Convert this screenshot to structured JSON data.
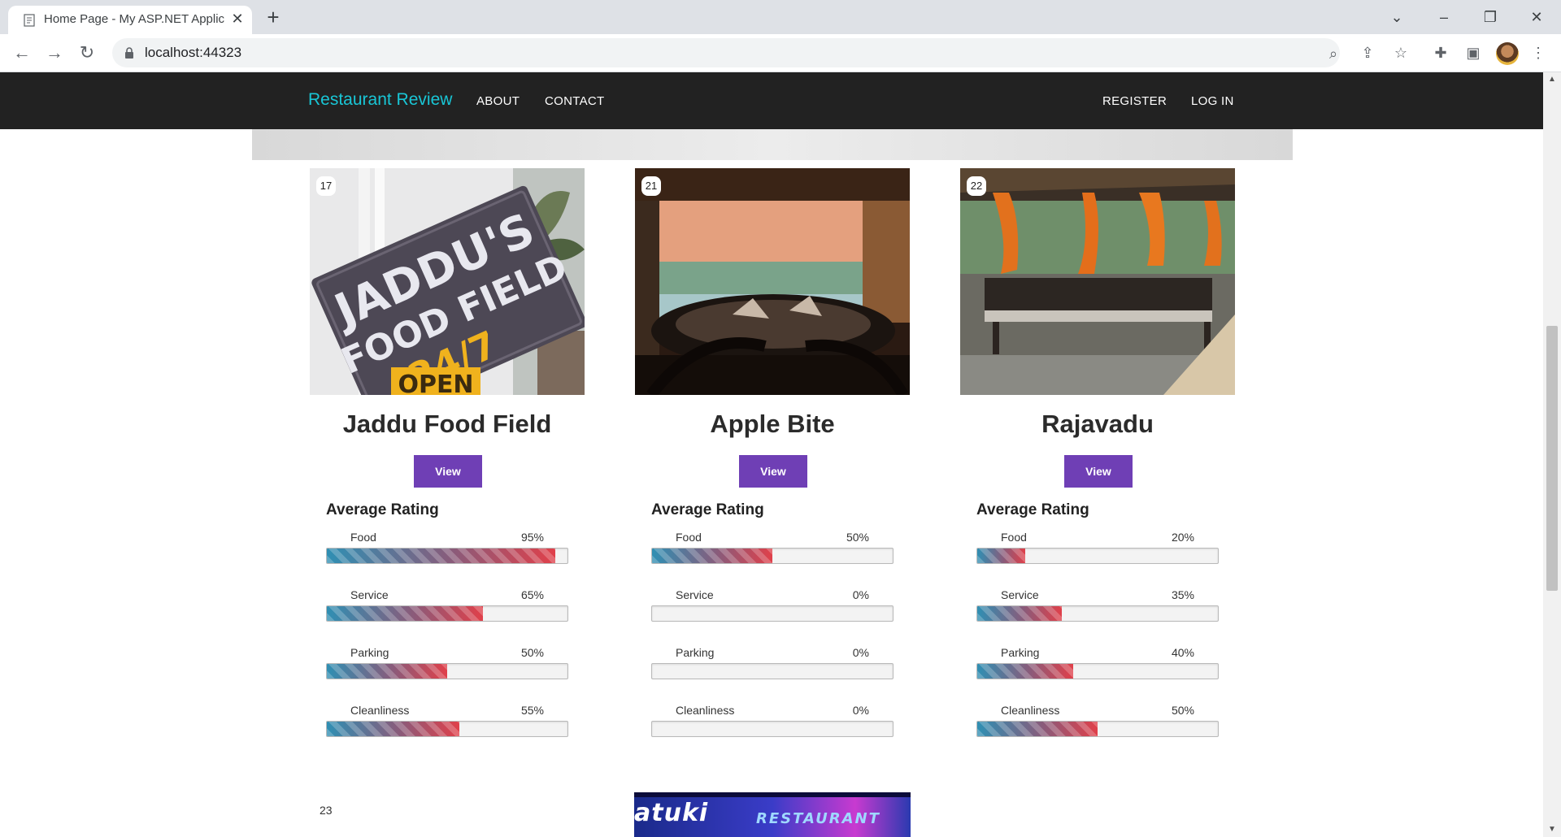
{
  "browser": {
    "tab_title": "Home Page - My ASP.NET Applic",
    "url": "localhost:44323"
  },
  "navbar": {
    "brand": "Restaurant Review",
    "links": [
      "ABOUT",
      "CONTACT"
    ],
    "right_links": [
      "REGISTER",
      "LOG IN"
    ]
  },
  "section_title": "Average Rating",
  "restaurants": [
    {
      "id": "17",
      "name": "Jaddu Food Field",
      "view_label": "View",
      "ratings": [
        {
          "label": "Food",
          "pct": "95%",
          "value": 95
        },
        {
          "label": "Service",
          "pct": "65%",
          "value": 65
        },
        {
          "label": "Parking",
          "pct": "50%",
          "value": 50
        },
        {
          "label": "Cleanliness",
          "pct": "55%",
          "value": 55
        }
      ]
    },
    {
      "id": "21",
      "name": "Apple Bite",
      "view_label": "View",
      "ratings": [
        {
          "label": "Food",
          "pct": "50%",
          "value": 50
        },
        {
          "label": "Service",
          "pct": "0%",
          "value": 0
        },
        {
          "label": "Parking",
          "pct": "0%",
          "value": 0
        },
        {
          "label": "Cleanliness",
          "pct": "0%",
          "value": 0
        }
      ]
    },
    {
      "id": "22",
      "name": "Rajavadu",
      "view_label": "View",
      "ratings": [
        {
          "label": "Food",
          "pct": "20%",
          "value": 20
        },
        {
          "label": "Service",
          "pct": "35%",
          "value": 35
        },
        {
          "label": "Parking",
          "pct": "40%",
          "value": 40
        },
        {
          "label": "Cleanliness",
          "pct": "50%",
          "value": 50
        }
      ]
    }
  ],
  "next_row": {
    "id": "23",
    "banner_text": "atuki",
    "banner_subtext": "RESTAURANT"
  },
  "colors": {
    "navbar_bg": "#222222",
    "brand": "#19c6d6",
    "view_button": "#6f3fb5"
  }
}
